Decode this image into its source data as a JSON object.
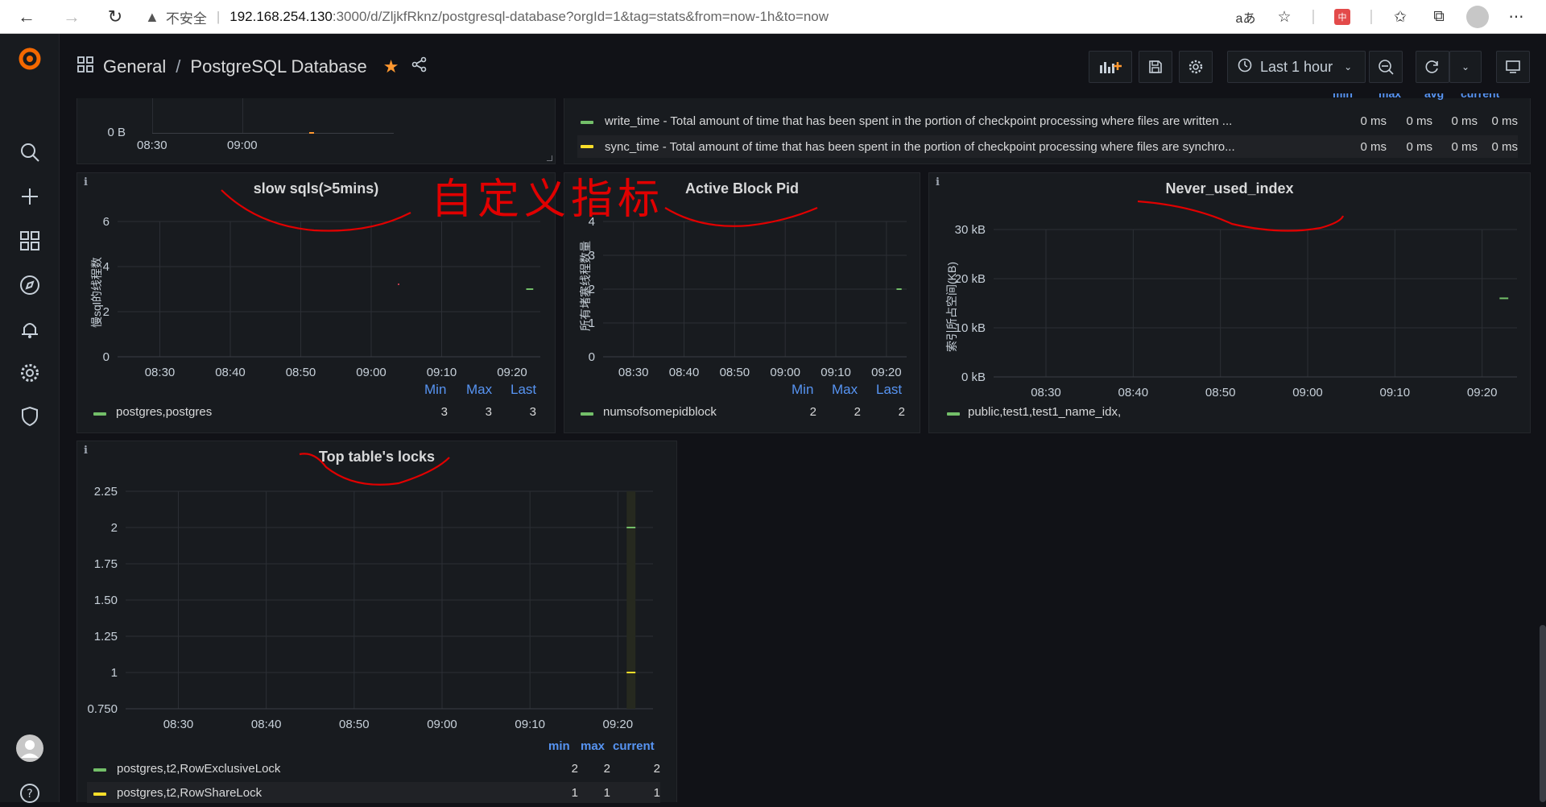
{
  "browser": {
    "insecure_label": "不安全",
    "url_host": "192.168.254.130",
    "url_path": ":3000/d/ZljkfRknz/postgresql-database?orgId=1&tag=stats&from=now-1h&to=now",
    "read_aloud": "aあ",
    "ext_badge": "中"
  },
  "nav": {
    "folder": "General",
    "separator": "/",
    "dashboard": "PostgreSQL Database",
    "time_range": "Last 1 hour"
  },
  "annotation": {
    "handwritten_text": "自定义指标",
    "ink_color": "#e00000"
  },
  "colors": {
    "green": "#73bf69",
    "yellow": "#fade2a",
    "red_point": "#f2495c",
    "blue_header": "#5794f2",
    "panel_bg": "#181b1f",
    "page_bg": "#111217"
  },
  "top_left_panel": {
    "y_tick": "0 B",
    "x_ticks": [
      "08:30",
      "09:00"
    ]
  },
  "checkpoint_panel": {
    "headers": [
      "min",
      "max",
      "avg",
      "current"
    ],
    "rows": [
      {
        "label": "write_time - Total amount of time that has been spent in the portion of checkpoint processing where files are written ...",
        "values": [
          "0 ms",
          "0 ms",
          "0 ms",
          "0 ms"
        ],
        "color": "#73bf69"
      },
      {
        "label": "sync_time - Total amount of time that has been spent in the portion of checkpoint processing where files are synchro...",
        "values": [
          "0 ms",
          "0 ms",
          "0 ms",
          "0 ms"
        ],
        "color": "#fade2a"
      }
    ]
  },
  "slow_sqls": {
    "title": "slow sqls(>5mins)",
    "ylabel": "慢sql的线程数",
    "y_ticks": [
      "6",
      "4",
      "2",
      "0"
    ],
    "x_ticks": [
      "08:30",
      "08:40",
      "08:50",
      "09:00",
      "09:10",
      "09:20"
    ],
    "legend_headers": [
      "Min",
      "Max",
      "Last"
    ],
    "legend": [
      {
        "name": "postgres,postgres",
        "values": [
          "3",
          "3",
          "3"
        ],
        "color": "#73bf69"
      }
    ]
  },
  "active_block": {
    "title": "Active Block Pid",
    "ylabel": "所有堵塞线程数量",
    "y_ticks": [
      "4",
      "3",
      "2",
      "1",
      "0"
    ],
    "x_ticks": [
      "08:30",
      "08:40",
      "08:50",
      "09:00",
      "09:10",
      "09:20"
    ],
    "legend_headers": [
      "Min",
      "Max",
      "Last"
    ],
    "legend": [
      {
        "name": "numsofsomepidblock",
        "values": [
          "2",
          "2",
          "2"
        ],
        "color": "#73bf69"
      }
    ]
  },
  "never_used": {
    "title": "Never_used_index",
    "ylabel": "索引所占空间(KB)",
    "y_ticks": [
      "30 kB",
      "20 kB",
      "10 kB",
      "0 kB"
    ],
    "x_ticks": [
      "08:30",
      "08:40",
      "08:50",
      "09:00",
      "09:10",
      "09:20"
    ],
    "legend": [
      {
        "name": "public,test1,test1_name_idx,",
        "color": "#73bf69"
      }
    ]
  },
  "top_locks": {
    "title": "Top table's locks",
    "y_ticks": [
      "2.25",
      "2",
      "1.75",
      "1.50",
      "1.25",
      "1",
      "0.750"
    ],
    "x_ticks": [
      "08:30",
      "08:40",
      "08:50",
      "09:00",
      "09:10",
      "09:20"
    ],
    "legend_headers": [
      "min",
      "max",
      "current"
    ],
    "legend": [
      {
        "name": "postgres,t2,RowExclusiveLock",
        "values": [
          "2",
          "2",
          "2"
        ],
        "color": "#73bf69"
      },
      {
        "name": "postgres,t2,RowShareLock",
        "values": [
          "1",
          "1",
          "1"
        ],
        "color": "#fade2a"
      }
    ]
  },
  "chart_data": [
    {
      "type": "line",
      "title": "slow sqls(>5mins)",
      "ylabel": "慢sql的线程数",
      "ylim": [
        0,
        6
      ],
      "x": [
        "09:22",
        "09:23"
      ],
      "series": [
        {
          "name": "postgres,postgres",
          "values": [
            3,
            3
          ]
        }
      ]
    },
    {
      "type": "line",
      "title": "Active Block Pid",
      "ylabel": "所有堵塞线程数量",
      "ylim": [
        0,
        4
      ],
      "x": [
        "09:22",
        "09:23"
      ],
      "series": [
        {
          "name": "numsofsomepidblock",
          "values": [
            2,
            2
          ]
        }
      ]
    },
    {
      "type": "line",
      "title": "Never_used_index",
      "ylabel": "索引所占空间(KB)",
      "ylim": [
        0,
        30
      ],
      "x": [
        "09:22",
        "09:23"
      ],
      "series": [
        {
          "name": "public,test1,test1_name_idx,",
          "values": [
            16,
            16
          ]
        }
      ]
    },
    {
      "type": "line",
      "title": "Top table's locks",
      "ylim": [
        0.75,
        2.25
      ],
      "x": [
        "09:21",
        "09:22"
      ],
      "series": [
        {
          "name": "postgres,t2,RowExclusiveLock",
          "values": [
            2,
            2
          ]
        },
        {
          "name": "postgres,t2,RowShareLock",
          "values": [
            1,
            1
          ]
        }
      ]
    }
  ]
}
